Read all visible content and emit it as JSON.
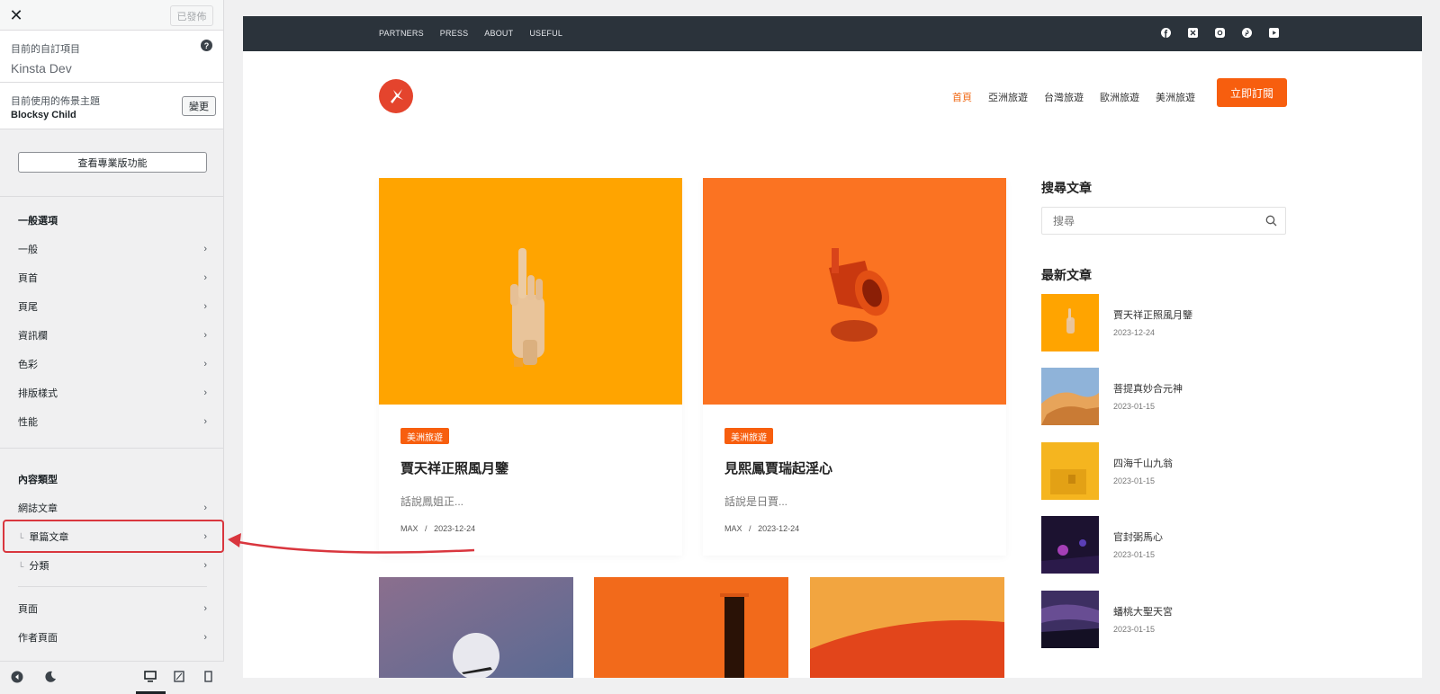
{
  "sidebar": {
    "close_icon": "close-icon",
    "published_label": "已發佈",
    "current_customizing_label": "目前的自訂項目",
    "site_name": "Kinsta Dev",
    "active_theme_label": "目前使用的佈景主題",
    "theme_name": "Blocksy Child",
    "change_label": "變更",
    "pro_features_label": "查看專業版功能",
    "general_section": "一般選項",
    "general_items": [
      "一般",
      "頁首",
      "頁尾",
      "資訊欄",
      "色彩",
      "排版樣式",
      "性能"
    ],
    "content_section": "內容類型",
    "content_items": [
      "網誌文章",
      "單篇文章",
      "分類"
    ],
    "page_items": [
      "頁面",
      "作者頁面"
    ]
  },
  "preview": {
    "top_nav": [
      "PARTNERS",
      "PRESS",
      "ABOUT",
      "USEFUL"
    ],
    "social_icons": [
      "facebook-icon",
      "x-icon",
      "instagram-icon",
      "pinterest-icon",
      "youtube-icon"
    ],
    "main_nav": [
      "首頁",
      "亞洲旅遊",
      "台灣旅遊",
      "歐洲旅遊",
      "美洲旅遊"
    ],
    "subscribe_label": "立即訂閱",
    "posts": [
      {
        "tag": "美洲旅遊",
        "title": "賈天祥正照風月鑒",
        "excerpt": "話說鳳姐正...",
        "author": "MAX",
        "date": "2023-12-24",
        "color": "#ffa400"
      },
      {
        "tag": "美洲旅遊",
        "title": "見熙鳳賈瑞起淫心",
        "excerpt": "話說是日賈...",
        "author": "MAX",
        "date": "2023-12-24",
        "color": "#fb7322"
      }
    ],
    "search_widget_title": "搜尋文章",
    "search_placeholder": "搜尋",
    "recent_widget_title": "最新文章",
    "recent_posts": [
      {
        "title": "賈天祥正照風月鑒",
        "date": "2023-12-24"
      },
      {
        "title": "菩提真妙合元神",
        "date": "2023-01-15"
      },
      {
        "title": "四海千山九翁",
        "date": "2023-01-15"
      },
      {
        "title": "官封弼馬心",
        "date": "2023-01-15"
      },
      {
        "title": "蟠桃大聖天宮",
        "date": "2023-01-15"
      }
    ],
    "date_separator": "/"
  },
  "colors": {
    "accent": "#f75e0e",
    "topbar": "#2b333b",
    "highlight": "#d9363e"
  }
}
